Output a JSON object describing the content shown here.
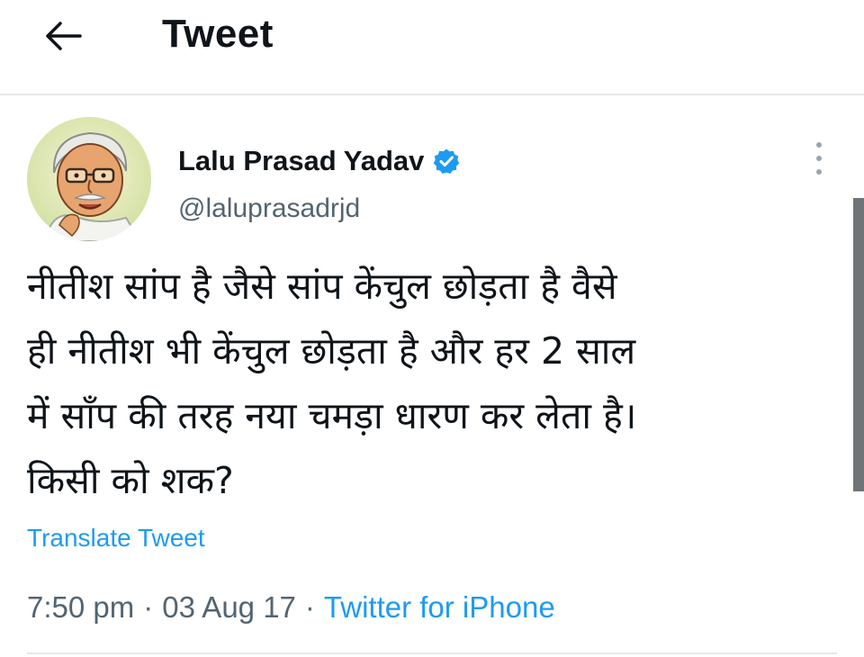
{
  "header": {
    "back_icon": "arrow-left-icon",
    "title": "Tweet"
  },
  "tweet": {
    "author": {
      "name": "Lalu Prasad Yadav",
      "handle": "@laluprasadrjd",
      "verified_icon": "verified-badge-icon",
      "avatar_icon": "avatar"
    },
    "more_icon": "more-vertical-icon",
    "text": "नीतीश सांप है जैसे सांप केंचुल छोड़ता है वैसे\nही नीतीश भी केंचुल छोड़ता है और हर 2 साल\nमें साँप की तरह नया चमड़ा धारण कर लेता है।\nकिसी को शक?",
    "translate_label": "Translate Tweet",
    "meta": {
      "time": "7:50 pm",
      "separator": "·",
      "date": "03 Aug 17",
      "source": "Twitter for iPhone"
    }
  },
  "colors": {
    "text": "#0f1419",
    "secondary": "#536471",
    "accent": "#1d9bf0",
    "divider": "#e6e8ea"
  }
}
